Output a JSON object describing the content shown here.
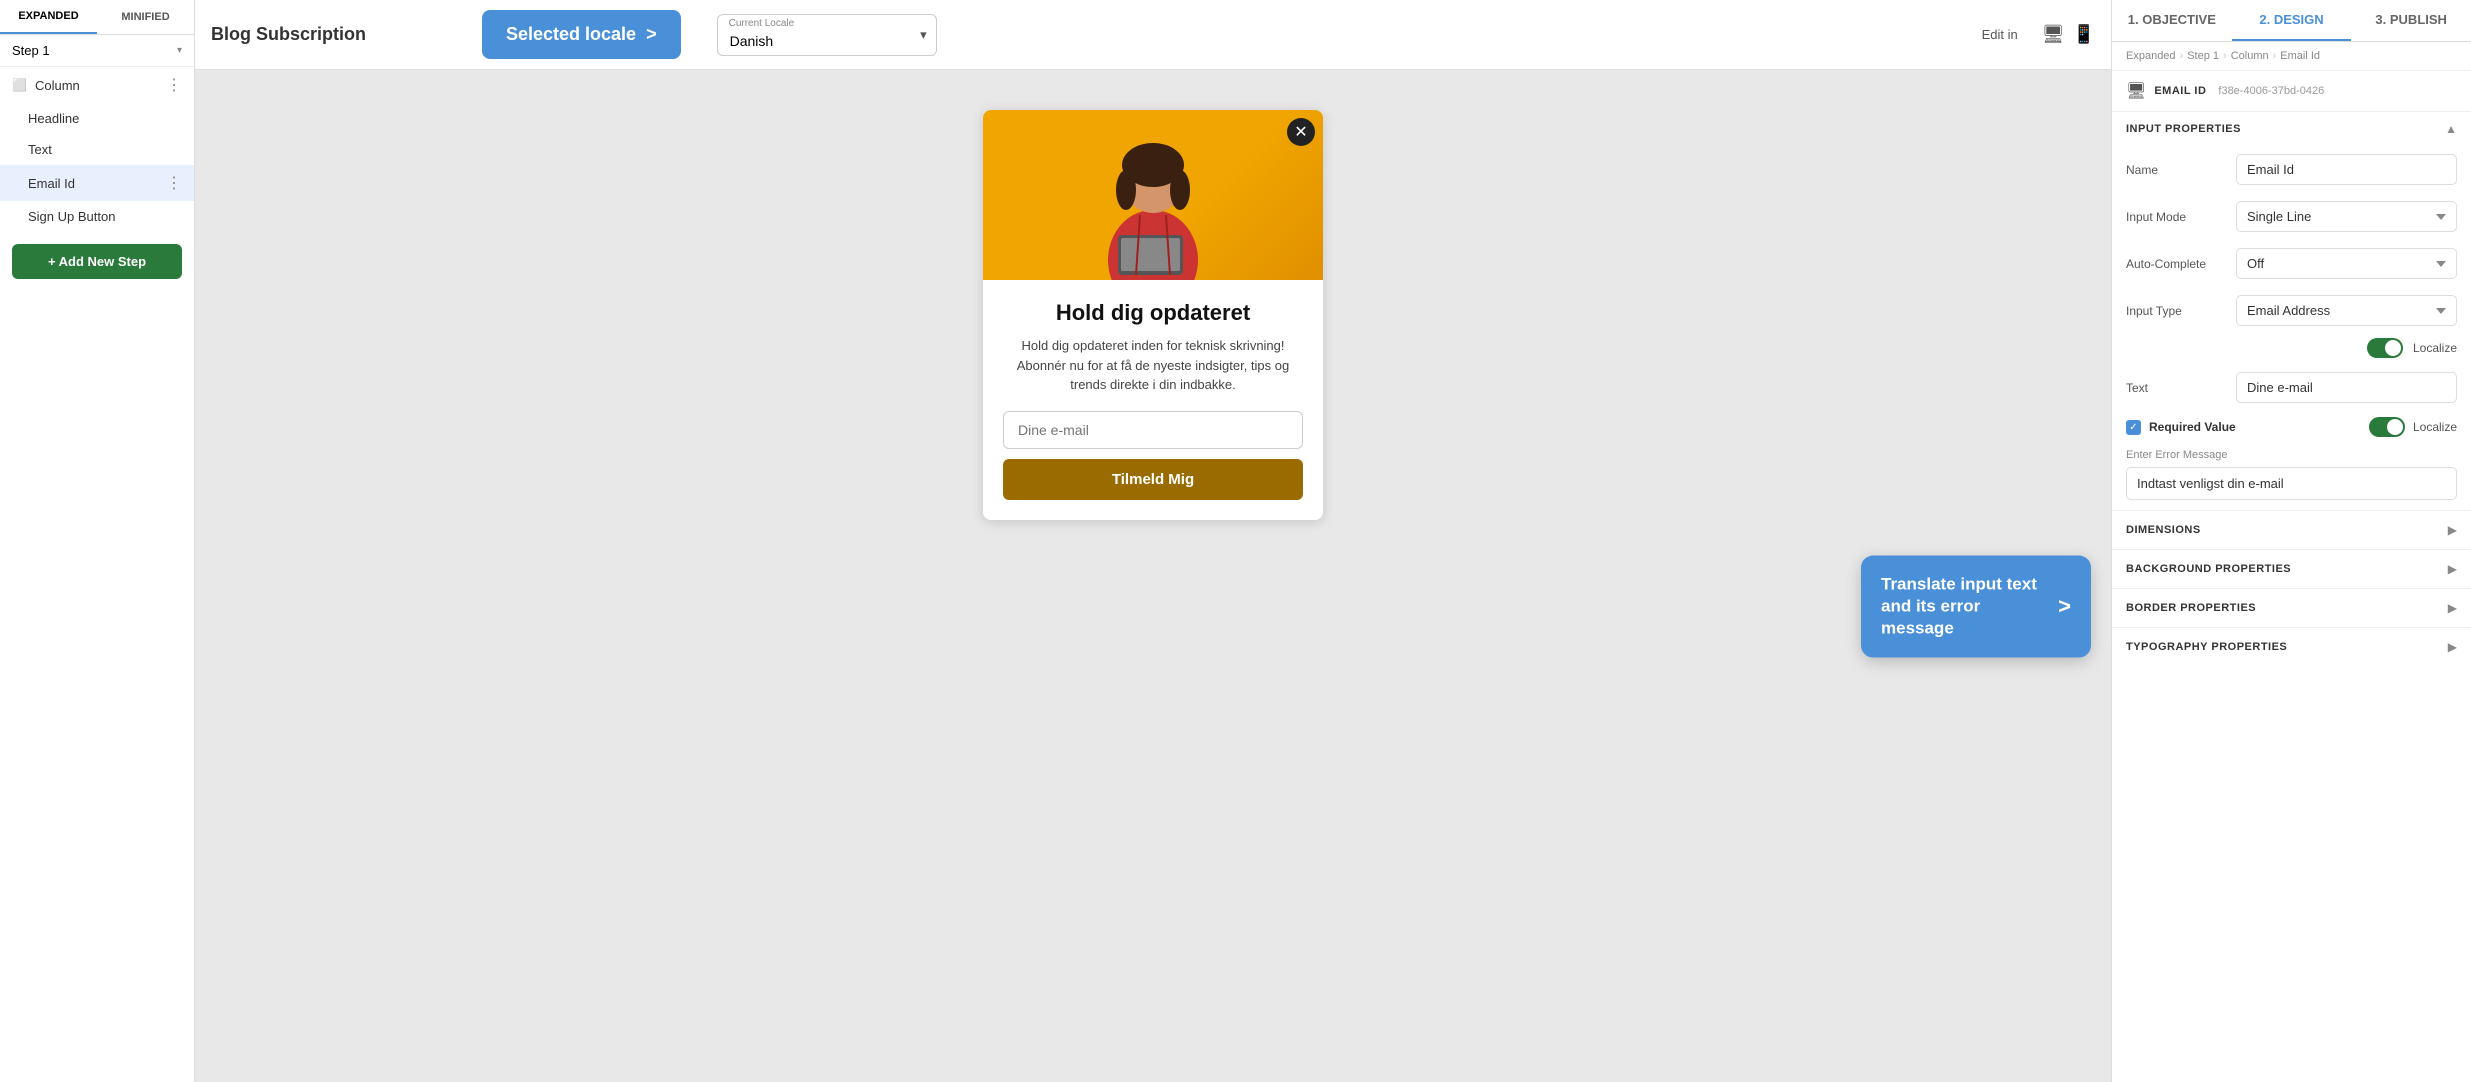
{
  "app": {
    "title": "Blog Subscription"
  },
  "left_tabs": {
    "expanded_label": "EXPANDED",
    "minified_label": "MINIFIED",
    "active": "expanded"
  },
  "step_selector": {
    "label": "Step 1"
  },
  "tree": {
    "column_label": "Column",
    "headline_label": "Headline",
    "text_label": "Text",
    "email_id_label": "Email Id",
    "sign_up_label": "Sign Up Button"
  },
  "add_step_btn": "+ Add New Step",
  "top_bar": {
    "selected_locale_label": "Selected locale",
    "selected_locale_arrow": ">",
    "current_locale_label": "Current Locale",
    "locale_value": "Danish",
    "edit_in_label": "Edit in"
  },
  "translate_tooltip": {
    "text": "Translate input text and its error message",
    "arrow": ">"
  },
  "form_card": {
    "title": "Hold dig opdateret",
    "subtitle": "Hold dig opdateret inden for teknisk skrivning! Abonnér nu for at få de nyeste indsigter, tips og trends direkte i din indbakke.",
    "input_placeholder": "Dine e-mail",
    "submit_label": "Tilmeld Mig"
  },
  "right_panel": {
    "tabs": [
      {
        "label": "1. OBJECTIVE",
        "active": false
      },
      {
        "label": "2. DESIGN",
        "active": true
      },
      {
        "label": "3. PUBLISH",
        "active": false
      }
    ],
    "breadcrumb": [
      "Expanded",
      "Step 1",
      "Column",
      "Email Id"
    ],
    "email_id": {
      "icon": "monitor",
      "title": "EMAIL ID",
      "uuid": "f38e-4006-37bd-0426"
    },
    "sections": {
      "input_properties": "INPUT PROPERTIES",
      "dimensions": "DIMENSIONS",
      "background_properties": "BACKGROUND PROPERTIES",
      "border_properties": "BORDER PROPERTIES",
      "typography_properties": "TYPOGRAPHY PROPERTIES"
    },
    "properties": {
      "name_label": "Name",
      "name_value": "Email Id",
      "input_mode_label": "Input Mode",
      "input_mode_value": "Single Line",
      "auto_complete_label": "Auto-Complete",
      "auto_complete_value": "Off",
      "input_type_label": "Input Type",
      "input_type_value": "Email Address",
      "localize_label": "Localize",
      "text_label": "Text",
      "text_value": "Dine e-mail",
      "required_value_label": "Required Value",
      "enter_error_label": "Enter Error Message",
      "error_msg_value": "Indtast venligst din e-mail"
    }
  }
}
